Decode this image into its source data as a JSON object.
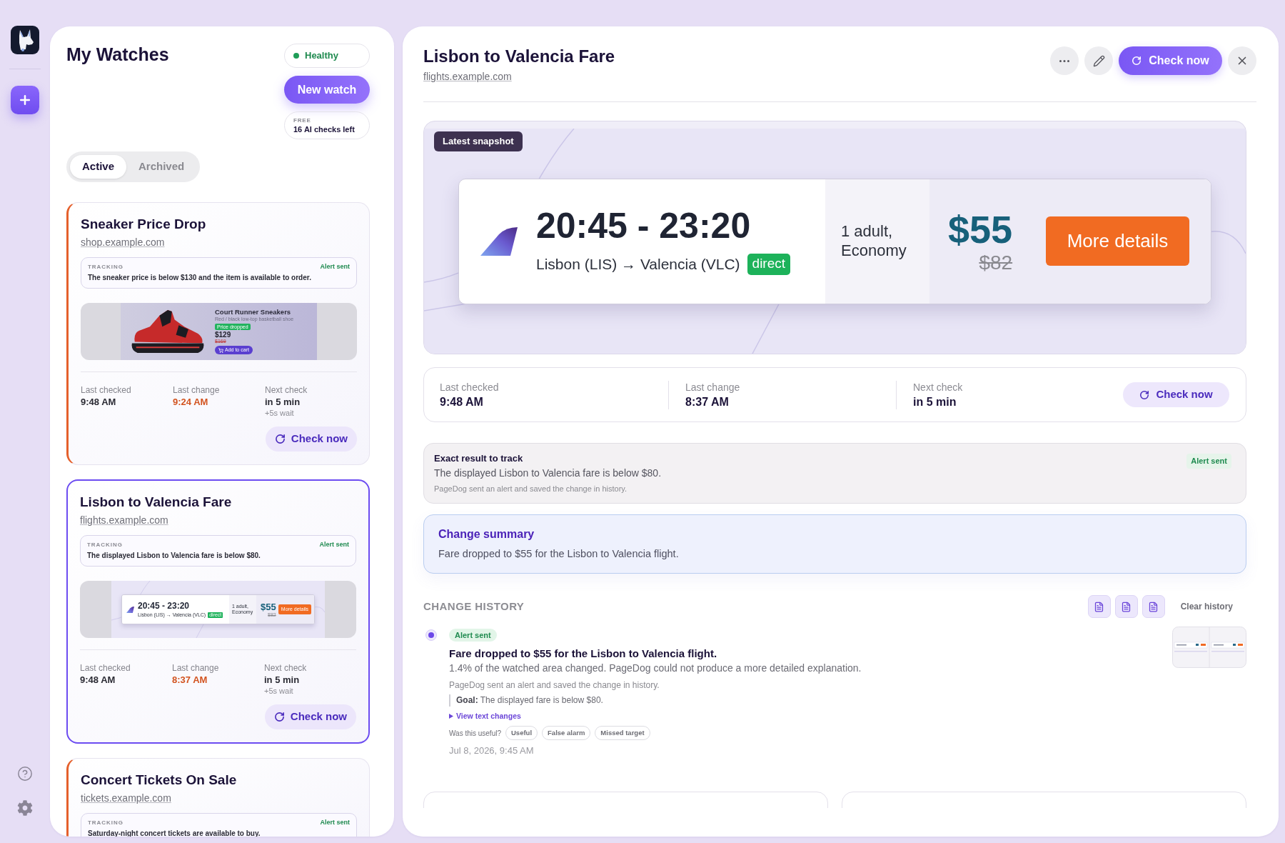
{
  "watches_panel": {
    "title": "My Watches",
    "status": "Healthy",
    "new_watch_button": "New watch",
    "plan": {
      "tier": "FREE",
      "checks_left": "16 AI checks left"
    },
    "tabs": [
      {
        "label": "Active",
        "selected": true
      },
      {
        "label": "Archived",
        "selected": false
      }
    ],
    "watches": [
      {
        "title": "Sneaker Price Drop",
        "url": "shop.example.com",
        "selected": false,
        "tracking_label": "TRACKING",
        "alert": "Alert sent",
        "tracking": "The sneaker price is below $130 and the item is available to order.",
        "snapshot": {
          "kind": "product",
          "name": "Court Runner Sneakers",
          "subtitle": "Red / black low-top basketball shoe",
          "badge": "Price dropped",
          "price": "$129",
          "old_price": "$169",
          "button": "Add to cart"
        },
        "stats": [
          {
            "label": "Last checked",
            "value": "9:48 AM",
            "highlighted": false
          },
          {
            "label": "Last change",
            "value": "9:24 AM",
            "highlighted": true
          },
          {
            "label": "Next check",
            "value": "in 5 min",
            "note": "+5s wait",
            "highlighted": false
          }
        ],
        "check_button": "Check now"
      },
      {
        "title": "Lisbon to Valencia Fare",
        "url": "flights.example.com",
        "selected": true,
        "tracking_label": "TRACKING",
        "alert": "Alert sent",
        "tracking": "The displayed Lisbon to Valencia fare is below $80.",
        "snapshot": {
          "kind": "flight",
          "times": "20:45 - 23:20",
          "route": "Lisbon (LIS) → Valencia (VLC)",
          "stops": "direct",
          "passengers": "1 adult, Economy",
          "price": "$55",
          "old_price": "$82",
          "button": "More details"
        },
        "stats": [
          {
            "label": "Last checked",
            "value": "9:48 AM",
            "highlighted": false
          },
          {
            "label": "Last change",
            "value": "8:37 AM",
            "highlighted": true
          },
          {
            "label": "Next check",
            "value": "in 5 min",
            "note": "+5s wait",
            "highlighted": false
          }
        ],
        "check_button": "Check now"
      },
      {
        "title": "Concert Tickets On Sale",
        "url": "tickets.example.com",
        "selected": false,
        "tracking_label": "TRACKING",
        "alert": "Alert sent",
        "tracking": "Saturday-night concert tickets are available to buy."
      }
    ]
  },
  "detail": {
    "title": "Lisbon to Valencia Fare",
    "url": "flights.example.com",
    "check_button": "Check now",
    "snapshot": {
      "badge": "Latest snapshot",
      "kind": "flight",
      "times": "20:45 - 23:20",
      "route": "Lisbon (LIS) → Valencia (VLC)",
      "stops": "direct",
      "passengers": "1 adult, Economy",
      "price": "$55",
      "old_price": "$82",
      "button": "More details"
    },
    "stats": [
      {
        "label": "Last checked",
        "value": "9:48 AM",
        "highlighted": false
      },
      {
        "label": "Last change",
        "value": "8:37 AM",
        "highlighted": false
      },
      {
        "label": "Next check",
        "value": "in 5 min",
        "highlighted": false
      }
    ],
    "stats_button": "Check now",
    "target": {
      "heading": "Exact result to track",
      "text": "The displayed Lisbon to Valencia fare is below $80.",
      "note": "PageDog sent an alert and saved the change in history.",
      "status": "Alert sent"
    },
    "summary": {
      "heading": "Change summary",
      "text": "Fare dropped to $55 for the Lisbon to Valencia flight."
    },
    "history": {
      "heading": "CHANGE HISTORY",
      "clear_button": "Clear history",
      "entries": [
        {
          "badge": "Alert sent",
          "title": "Fare dropped to $55 for the Lisbon to Valencia flight.",
          "description": "1.4% of the watched area changed. PageDog could not produce a more detailed explanation.",
          "note": "PageDog sent an alert and saved the change in history.",
          "goal": "**Goal:** The displayed fare is below $80.",
          "changes_toggle": {
            "label": "View text changes",
            "expanded": false
          },
          "feedback_prompt": "Was this useful?",
          "feedback_options": [
            "Useful",
            "False alarm",
            "Missed target"
          ],
          "date": "Jul 8, 2026, 9:45 AM"
        }
      ]
    }
  }
}
